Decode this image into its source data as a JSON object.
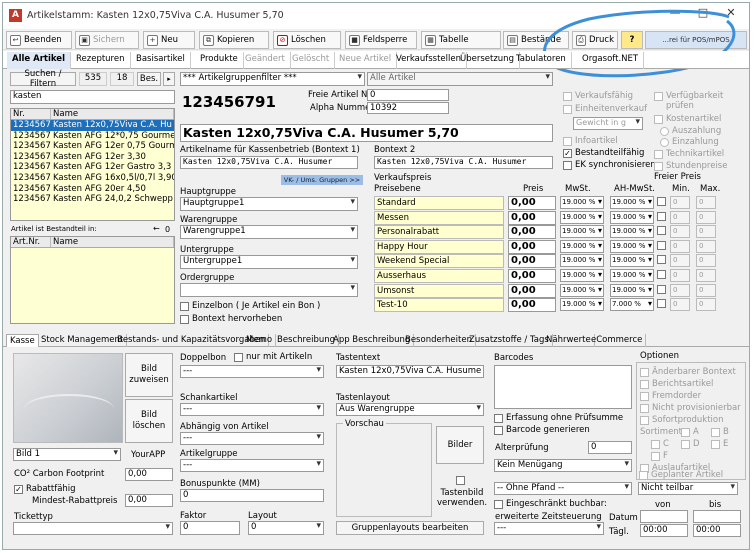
{
  "window": {
    "title": "Artikelstamm: Kasten 12x0,75Viva C.A. Husumer 5,70"
  },
  "toolbar": {
    "beenden": "Beenden",
    "sichern": "Sichern",
    "neu": "Neu",
    "kopieren": "Kopieren",
    "loeschen": "Löschen",
    "feldsperre": "Feldsperre",
    "tabelle": "Tabelle",
    "bestaende": "Bestände",
    "druck": "Druck",
    "help": "?",
    "pos_label": "...rei für POS/mPOS"
  },
  "tabs": [
    "Alle Artikel",
    "Rezepturen",
    "Basisartikel",
    "Produkte",
    "Geändert",
    "Gelöscht",
    "Neue Artikel",
    "Verkaufsstellen",
    "Übersetzung",
    "Tabulatoren",
    "Orgasoft.NET"
  ],
  "search": {
    "label": "Suchen / Filtern",
    "count1": "535",
    "count2": "18",
    "bes": "Bes.",
    "query": "kasten",
    "group_filter": "*** Artikelgruppenfilter ***",
    "alle_artikel": "Alle Artikel"
  },
  "article_list": {
    "headers": [
      "Nr.",
      "Name"
    ],
    "rows": [
      {
        "nr": "1234567",
        "name": "Kasten 12x0,75Viva C.A. Hu"
      },
      {
        "nr": "1234567",
        "name": "Kasten AFG 12*0,75 Gourme"
      },
      {
        "nr": "1234567",
        "name": "Kasten AFG 12er 0,75 Gourme"
      },
      {
        "nr": "1234567",
        "name": "Kasten AFG 12er 3,30"
      },
      {
        "nr": "1234567",
        "name": "Kasten AFG 12er Gastro 3,3"
      },
      {
        "nr": "1234567",
        "name": "Kasten AFG 16x0,5l/0,7l 3,90"
      },
      {
        "nr": "1234567",
        "name": "Kasten AFG 20er 4,50"
      },
      {
        "nr": "1234567",
        "name": "Kasten AFG 24,0,2 Schwepp"
      }
    ]
  },
  "bestandteil": {
    "label": "Artikel ist Bestandteil in:",
    "count": "0",
    "headers": [
      "Art.Nr.",
      "Name"
    ]
  },
  "article": {
    "number": "123456791",
    "freie_nr_label": "Freie Artikel Nr",
    "freie_nr": "0",
    "alpha_label": "Alpha Nummer",
    "alpha": "10392",
    "name": "Kasten 12x0,75Viva C.A. Husumer 5,70",
    "kassen_label": "Artikelname für Kassenbetrieb (Bontext 1)",
    "kassen_name": "Kasten 12x0,75Viva C.A. Husumer",
    "bontext2_label": "Bontext 2",
    "bontext2": "Kasten 12x0,75Viva C.A. Husumer",
    "vk_link": "VK- / Ums. Gruppen >>"
  },
  "groups": {
    "haupt_label": "Hauptgruppe",
    "haupt": "Hauptgruppe1",
    "waren_label": "Warengruppe",
    "waren": "Warengruppe1",
    "unter_label": "Untergruppe",
    "unter": "Untergruppe1",
    "order_label": "Ordergruppe",
    "order": "",
    "einzelbon": "Einzelbon ( Je Artikel ein Bon )",
    "bontext_hervorheben": "Bontext hervorheben"
  },
  "right_options": {
    "verkaufsfaehig": "Verkaufsfähig",
    "einheitenverkauf": "Einheitenverkauf",
    "gewicht": "Gewicht in g",
    "infoartikel": "Infoartikel",
    "bestandteilfaehig": "Bestandteilfähig",
    "ek_sync": "EK synchronisieren",
    "verfuegbarkeit": "Verfügbarkeit prüfen",
    "kostenartikel": "Kostenartikel",
    "auszahlung": "Auszahlung",
    "einzahlung": "Einzahlung",
    "technikartikel": "Technikartikel",
    "stundenpreise": "Stundenpreise"
  },
  "prices": {
    "verkaufspreis_label": "Verkaufspreis",
    "preisebene_label": "Preisebene",
    "preis_label": "Preis",
    "mwst_label": "MwSt.",
    "ah_mwst_label": "AH-MwSt.",
    "freier_preis_label": "Freier Preis",
    "min_label": "Min.",
    "max_label": "Max.",
    "rows": [
      {
        "name": "Standard",
        "price": "0,00",
        "mwst": "19.000 %",
        "ah": "19.000 %",
        "min": "0",
        "max": "0"
      },
      {
        "name": "Messen",
        "price": "0,00",
        "mwst": "19.000 %",
        "ah": "19.000 %",
        "min": "0",
        "max": "0"
      },
      {
        "name": "Personalrabatt",
        "price": "0,00",
        "mwst": "19.000 %",
        "ah": "19.000 %",
        "min": "0",
        "max": "0"
      },
      {
        "name": "Happy Hour",
        "price": "0,00",
        "mwst": "19.000 %",
        "ah": "19.000 %",
        "min": "0",
        "max": "0"
      },
      {
        "name": "Weekend Special",
        "price": "0,00",
        "mwst": "19.000 %",
        "ah": "19.000 %",
        "min": "0",
        "max": "0"
      },
      {
        "name": "Ausserhaus",
        "price": "0,00",
        "mwst": "19.000 %",
        "ah": "19.000 %",
        "min": "0",
        "max": "0"
      },
      {
        "name": "Umsonst",
        "price": "0,00",
        "mwst": "19.000 %",
        "ah": "19.000 %",
        "min": "0",
        "max": "0"
      },
      {
        "name": "Test-10",
        "price": "0,00",
        "mwst": "19.000 %",
        "ah": "7.000 %",
        "min": "0",
        "max": "0"
      }
    ]
  },
  "bottom_tabs": [
    "Kasse",
    "Stock Management",
    "Bestands- und Kapazitätsvorgaben",
    "Memo",
    "Beschreibung",
    "App Beschreibung",
    "Besonderheiten",
    "Zusatzstoffe / Tags",
    "Nährwerte",
    "eCommerce"
  ],
  "kasse": {
    "bild_zuweisen": "Bild zuweisen",
    "bild_loeschen": "Bild löschen",
    "bild_select": "Bild 1",
    "yourapp": "YourAPP",
    "co2_label": "CO² Carbon Footprint",
    "co2": "0,00",
    "rabattfaehig": "Rabattfähig",
    "mindest_label": "Mindest-Rabattpreis",
    "mindest": "0,00",
    "tickettyp_label": "Tickettyp",
    "tickettyp": "",
    "doppelbon_label": "Doppelbon",
    "nur_mit_artikeln": "nur mit Artikeln",
    "doppelbon": "---",
    "schankartikel_label": "Schankartikel",
    "schankartikel": "---",
    "abhaengig_label": "Abhängig von Artikel",
    "abhaengig": "---",
    "artikelgruppe_label": "Artikelgruppe",
    "artikelgruppe": "---",
    "bonuspunkte_label": "Bonuspunkte (MM)",
    "bonuspunkte": "0",
    "faktor_label": "Faktor",
    "faktor": "0",
    "layout_label": "Layout",
    "layout": "0",
    "tastentext_label": "Tastentext",
    "tastentext": "Kasten 12x0,75Viva C.A. Husume",
    "tastenlayout_label": "Tastenlayout",
    "tastenlayout": "Aus Warengruppe",
    "vorschau_label": "Vorschau",
    "bilder": "Bilder",
    "tastenbild": "Tastenbild verwenden.",
    "gruppenlayouts": "Gruppenlayouts bearbeiten",
    "barcodes_label": "Barcodes",
    "erfassung": "Erfassung ohne Prüfsumme",
    "barcode_generieren": "Barcode generieren",
    "alterspruefung_label": "Alterprüfung",
    "alterspruefung": "0",
    "menuegang": "Kein Menügang",
    "pfand": "-- Ohne Pfand --",
    "eingeschraenkt": "Eingeschränkt buchbar:",
    "erweiterte_label": "erweiterte Zeitsteuerung",
    "erweiterte": "---",
    "datum_label": "Datum",
    "taegl_label": "Tägl.",
    "von_label": "von",
    "bis_label": "bis",
    "von_time": "00:00",
    "bis_time": "00:00"
  },
  "optionen": {
    "title": "Optionen",
    "items": [
      "Änderbarer Bontext",
      "Berichtsartikel",
      "Fremdorder",
      "Nicht provisionierbar",
      "Sofortproduktion"
    ],
    "sortiment_label": "Sortiment",
    "sort": [
      "A",
      "B",
      "C",
      "D",
      "E",
      "F"
    ],
    "auslaufartikel": "Auslaufartikel",
    "geplanter": "Geplanter Artikel",
    "teilbar": "Nicht teilbar"
  }
}
